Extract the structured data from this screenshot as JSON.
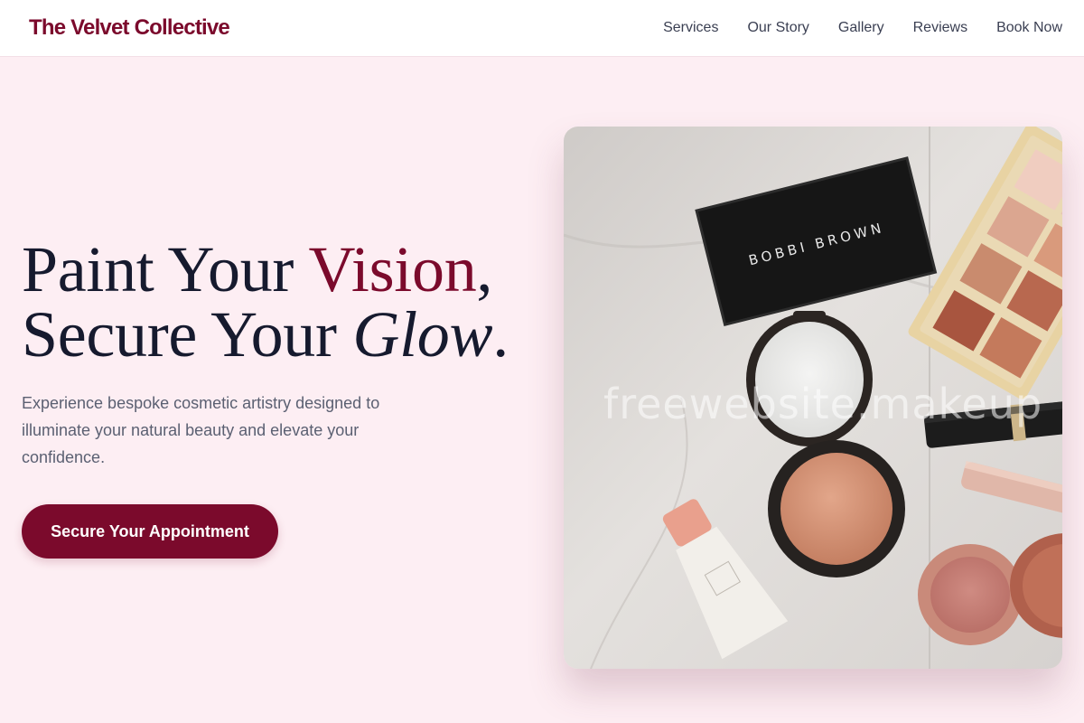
{
  "header": {
    "brand": "The Velvet Collective",
    "nav": [
      "Services",
      "Our Story",
      "Gallery",
      "Reviews",
      "Book Now"
    ]
  },
  "hero": {
    "line1_a": "Paint Your ",
    "line1_accent": "Vision",
    "line1_comma": ",",
    "line2_a": "Secure Your ",
    "line2_italic": "Glow",
    "line2_period": ".",
    "lede": "Experience bespoke cosmetic artistry designed to illuminate your natural beauty and elevate your confidence.",
    "cta": "Secure Your Appointment"
  },
  "photo": {
    "brand_on_compact": "BOBBI BROWN",
    "watermark": "freewebsite.makeup"
  },
  "colors": {
    "background": "#fdeef3",
    "accent": "#7b0a2c",
    "heading": "#161a2e",
    "body_text": "#5b6072"
  }
}
